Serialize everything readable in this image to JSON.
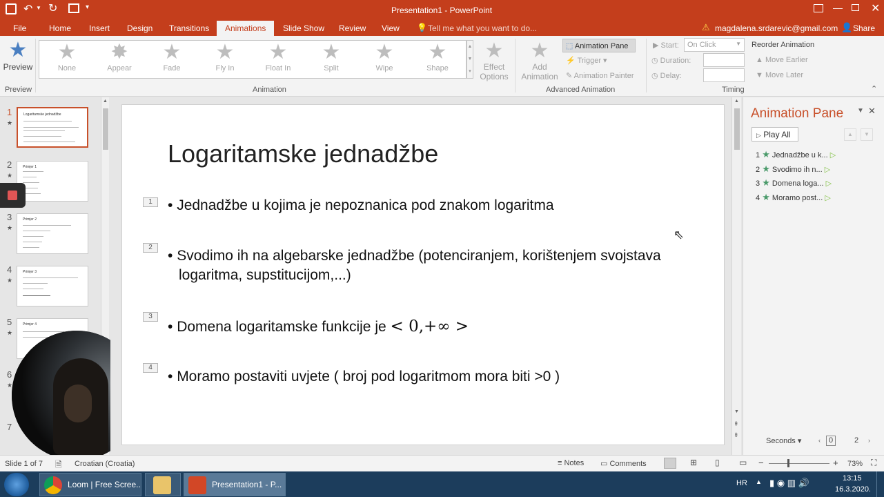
{
  "window": {
    "title": "Presentation1 - PowerPoint"
  },
  "tabs": [
    {
      "label": "File"
    },
    {
      "label": "Home"
    },
    {
      "label": "Insert"
    },
    {
      "label": "Design"
    },
    {
      "label": "Transitions"
    },
    {
      "label": "Animations"
    },
    {
      "label": "Slide Show"
    },
    {
      "label": "Review"
    },
    {
      "label": "View"
    }
  ],
  "tell_me": "Tell me what you want to do...",
  "account": "magdalena.srdarevic@gmail.com",
  "share": "Share",
  "ribbon": {
    "preview_label": "Preview",
    "preview_group": "Preview",
    "animation_group": "Animation",
    "gallery": [
      "None",
      "Appear",
      "Fade",
      "Fly In",
      "Float In",
      "Split",
      "Wipe",
      "Shape"
    ],
    "effect_options": [
      "Effect",
      "Options"
    ],
    "add_animation": [
      "Add",
      "Animation"
    ],
    "animation_pane": "Animation Pane",
    "trigger": "Trigger",
    "animation_painter": "Animation Painter",
    "advanced_group": "Advanced Animation",
    "start_label": "Start:",
    "start_value": "On Click",
    "duration_label": "Duration:",
    "delay_label": "Delay:",
    "reorder_title": "Reorder Animation",
    "move_earlier": "Move Earlier",
    "move_later": "Move Later",
    "timing_group": "Timing"
  },
  "thumbnails": {
    "numbers": [
      "1",
      "2",
      "3",
      "4",
      "5",
      "6",
      "7"
    ],
    "slide1_title": "Logaritamske jednadžbe",
    "slide2_title": "Primjer 1",
    "slide3_title": "Primjer 2",
    "slide4_title": "Primjer 3",
    "slide5_title": "Primjer 4"
  },
  "slide": {
    "title": "Logaritamske jednadžbe",
    "bullets": [
      {
        "num": "1",
        "text": "Jednadžbe u kojima je nepoznanica pod znakom logaritma"
      },
      {
        "num": "2",
        "text": "Svodimo ih na algebarske jednadžbe (potenciranjem, korištenjem svojstava logaritma, supstitucijom,...)"
      },
      {
        "num": "3",
        "text": "Domena logaritamske funkcije je ",
        "math": "< 0,+∞ >"
      },
      {
        "num": "4",
        "text": "Moramo postaviti uvjete ( broj pod logaritmom mora biti >0 )"
      }
    ]
  },
  "animation_pane": {
    "title": "Animation Pane",
    "play_all": "Play All",
    "items": [
      {
        "num": "1",
        "label": "Jednadžbe u k..."
      },
      {
        "num": "2",
        "label": "Svodimo ih n..."
      },
      {
        "num": "3",
        "label": "Domena loga..."
      },
      {
        "num": "4",
        "label": "Moramo post..."
      }
    ],
    "seconds": "Seconds",
    "timeline_start": "0",
    "timeline_end": "2"
  },
  "status": {
    "slide_info": "Slide 1 of 7",
    "language": "Croatian (Croatia)",
    "notes": "Notes",
    "comments": "Comments",
    "zoom": "73%"
  },
  "taskbar": {
    "items": [
      "Loom | Free Scree...",
      "",
      "Presentation1 - P..."
    ],
    "lang": "HR",
    "time": "13:15",
    "date": "16.3.2020."
  },
  "colors": {
    "accent": "#c43e1c",
    "taskbar": "#1c3d5c",
    "star_green": "#4a9a6a"
  }
}
